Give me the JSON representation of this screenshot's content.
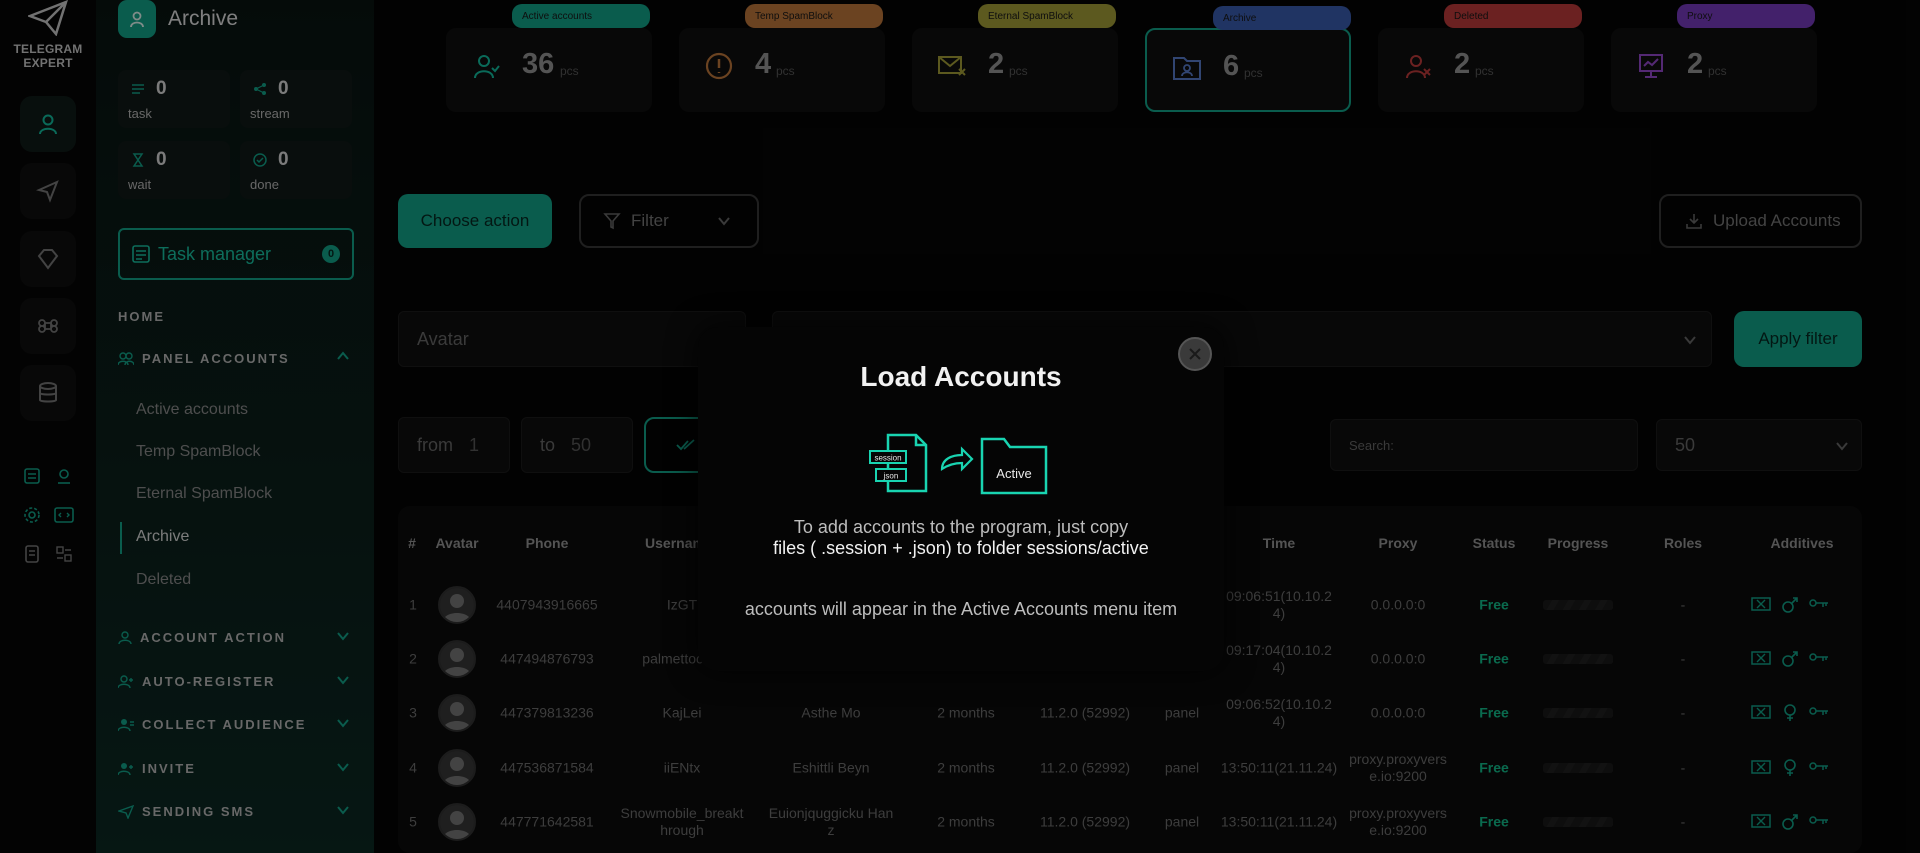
{
  "app": {
    "logo_line1": "TELEGRAM",
    "logo_line2": "EXPERT"
  },
  "panel": {
    "title": "Archive",
    "stats": [
      {
        "value": "0",
        "label": "task"
      },
      {
        "value": "0",
        "label": "stream"
      },
      {
        "value": "0",
        "label": "wait"
      },
      {
        "value": "0",
        "label": "done"
      }
    ],
    "task_manager": {
      "label": "Task manager",
      "count": "0"
    },
    "home": "HOME",
    "panel_accounts": "PANEL ACCOUNTS",
    "sub_items": [
      "Active accounts",
      "Temp SpamBlock",
      "Eternal SpamBlock",
      "Archive",
      "Deleted"
    ],
    "sections": [
      "ACCOUNT ACTION",
      "AUTO-REGISTER",
      "COLLECT AUDIENCE",
      "INVITE",
      "SENDING SMS"
    ]
  },
  "cards": [
    {
      "tag": "Active accounts",
      "value": "36",
      "unit": "pcs",
      "color": "#13a88d"
    },
    {
      "tag": "Temp SpamBlock",
      "value": "4",
      "unit": "pcs",
      "color": "#c47a3c"
    },
    {
      "tag": "Eternal SpamBlock",
      "value": "2",
      "unit": "pcs",
      "color": "#a8a33a"
    },
    {
      "tag": "Archive",
      "value": "6",
      "unit": "pcs",
      "color": "#3b5fb5"
    },
    {
      "tag": "Deleted",
      "value": "2",
      "unit": "pcs",
      "color": "#c43c3c"
    },
    {
      "tag": "Proxy",
      "value": "2",
      "unit": "pcs",
      "color": "#7a3cc4"
    }
  ],
  "toolbar": {
    "choose_action": "Choose action",
    "filter": "Filter",
    "upload": "Upload Accounts",
    "avatar_field": "Avatar",
    "apply_filter": "Apply filter",
    "from_label": "from",
    "from_value": "1",
    "to_label": "to",
    "to_value": "50",
    "search_placeholder": "Search:",
    "page_size": "50"
  },
  "table": {
    "headers": [
      "#",
      "Avatar",
      "Phone",
      "Usernam",
      "Time",
      "Proxy",
      "Status",
      "Progress",
      "Roles",
      "Additives"
    ],
    "rows": [
      {
        "n": "1",
        "phone": "4407943916665",
        "username": "IzGT",
        "name": "",
        "age": "",
        "version": "",
        "source": "",
        "time": "09:06:51(10.10.2\n4)",
        "proxy": "0.0.0.0:0",
        "status": "Free",
        "roles": "-"
      },
      {
        "n": "2",
        "phone": "447494876793",
        "username": "palmettocolo",
        "name": "",
        "age": "",
        "version": "",
        "source": "",
        "time": "09:17:04(10.10.2\n4)",
        "proxy": "0.0.0.0:0",
        "status": "Free",
        "roles": "-"
      },
      {
        "n": "3",
        "phone": "447379813236",
        "username": "KajLei",
        "name": "Asthe Mo",
        "age": "2 months",
        "version": "11.2.0 (52992)",
        "source": "panel",
        "time": "09:06:52(10.10.2\n4)",
        "proxy": "0.0.0.0:0",
        "status": "Free",
        "roles": "-"
      },
      {
        "n": "4",
        "phone": "447536871584",
        "username": "iiENtx",
        "name": "Eshittli Beyn",
        "age": "2 months",
        "version": "11.2.0 (52992)",
        "source": "panel",
        "time": "13:50:11(21.11.24)",
        "proxy": "proxy.proxyvers\ne.io:9200",
        "status": "Free",
        "roles": "-"
      },
      {
        "n": "5",
        "phone": "447771642581",
        "username": "Snowmobile_breakt\nhrough",
        "name": "Euionjquggicku Han\nz",
        "age": "2 months",
        "version": "11.2.0 (52992)",
        "source": "panel",
        "time": "13:50:11(21.11.24)",
        "proxy": "proxy.proxyvers\ne.io:9200",
        "status": "Free",
        "roles": "-"
      }
    ]
  },
  "modal": {
    "title": "Load Accounts",
    "file_label_1": "session",
    "file_label_2": "json",
    "folder_label": "Active",
    "line1": "To add accounts to the program, just copy",
    "line2": "files ( .session + .json) to folder sessions/active",
    "line3": "accounts will appear in the Active Accounts menu item"
  }
}
